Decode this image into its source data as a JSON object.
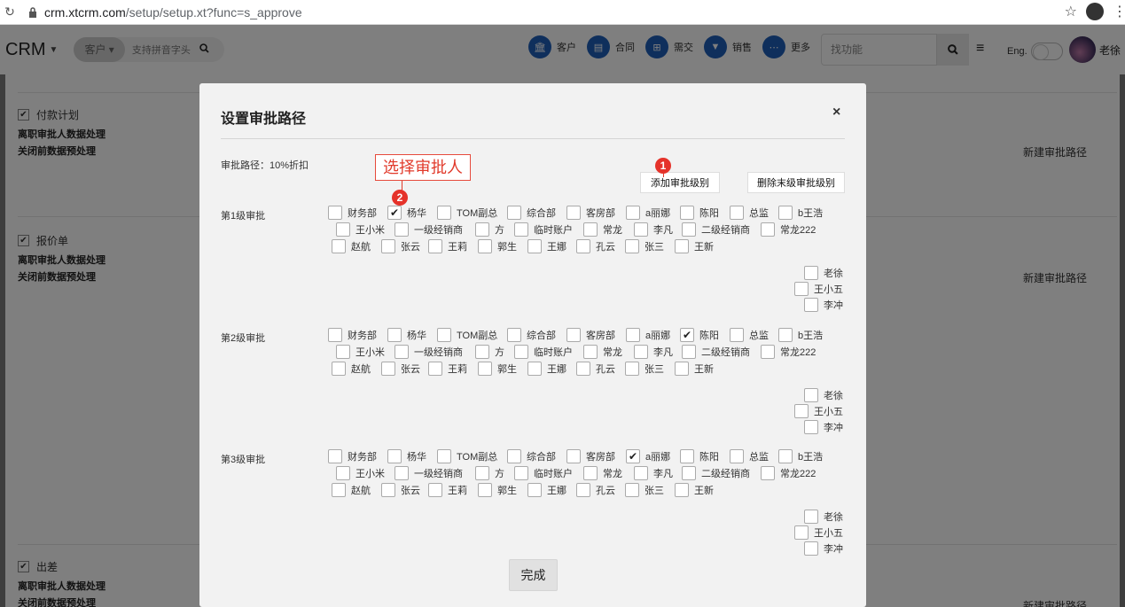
{
  "browser": {
    "url_host": "crm.xtcrm.com",
    "url_path": "/setup/setup.xt?func=s_approve"
  },
  "header": {
    "brand": "CRM",
    "search_scope": "客户",
    "search_placeholder": "支持拼音字头",
    "nav": [
      "客户",
      "合同",
      "需交",
      "销售",
      "更多"
    ],
    "find_placeholder": "找功能",
    "lang": "Eng.",
    "user": "老徐"
  },
  "background": {
    "sections": [
      {
        "title": "付款计划",
        "line1": "离职审批人数据处理",
        "line2": "关闭前数据预处理",
        "action": "新建审批路径"
      },
      {
        "title": "报价单",
        "line1": "离职审批人数据处理",
        "line2": "关闭前数据预处理",
        "action": "新建审批路径"
      },
      {
        "title": "出差",
        "line1": "离职审批人数据处理",
        "line2": "关闭前数据预处理",
        "action": "新建审批路径"
      }
    ]
  },
  "modal": {
    "title": "设置审批路径",
    "path_label": "审批路径：10%折扣",
    "add_level_button": "添加审批级别",
    "delete_last_level_button": "删除末级审批级别",
    "done_button": "完成",
    "close": "×",
    "levels": [
      {
        "label": "第1级审批",
        "checked": [
          "杨华"
        ]
      },
      {
        "label": "第2级审批",
        "checked": [
          "陈阳"
        ]
      },
      {
        "label": "第3级审批",
        "checked": [
          "a丽娜"
        ]
      }
    ],
    "approvers_row1": [
      "财务部",
      "杨华",
      "TOM副总",
      "综合部",
      "客房部",
      "a丽娜",
      "陈阳",
      "总监",
      "b王浩"
    ],
    "approvers_row2": [
      "王小米",
      "一级经销商",
      "方",
      "临时账户",
      "常龙",
      "李凡",
      "二级经销商",
      "常龙222"
    ],
    "approvers_row3": [
      "赵航",
      "张云",
      "王莉",
      "郭生",
      "王娜",
      "孔云",
      "张三",
      "王新"
    ],
    "approvers_right": [
      "老徐",
      "王小五",
      "李冲"
    ]
  },
  "annotations": {
    "callout_text": "选择审批人",
    "marker1": "1",
    "marker2": "2"
  },
  "colors": {
    "accent_blue": "#1f5fb8",
    "annotation_red": "#e13a2b"
  }
}
